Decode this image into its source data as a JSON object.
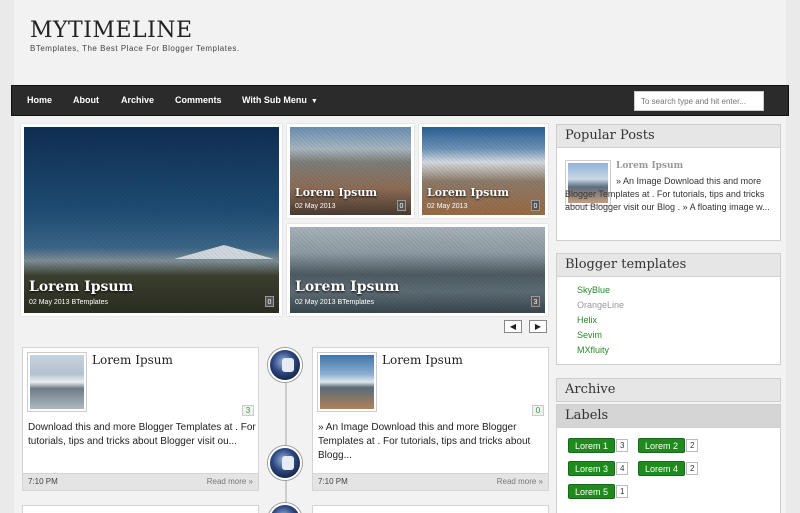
{
  "header": {
    "title": "MYTIMELINE",
    "description": "BTemplates, The Best Place For Blogger Templates."
  },
  "nav": {
    "items": [
      "Home",
      "About",
      "Archive",
      "Comments",
      "With Sub Menu"
    ],
    "submenu_icon": "caret-down-icon"
  },
  "search": {
    "placeholder": "To search type and hit enter..."
  },
  "slider": {
    "slides": [
      {
        "title": "Lorem Ipsum",
        "date": "02 May 2013",
        "author": "BTemplates",
        "comments": "0"
      },
      {
        "title": "Lorem Ipsum",
        "date": "02 May 2013",
        "comments": "0"
      },
      {
        "title": "Lorem Ipsum",
        "date": "02 May 2013",
        "comments": "0"
      },
      {
        "title": "Lorem Ipsum",
        "date": "02 May 2013",
        "author": "BTemplates",
        "comments": "3"
      }
    ],
    "prev_icon": "prev-arrow-icon",
    "next_icon": "next-arrow-icon"
  },
  "posts": [
    {
      "title": "Lorem Ipsum",
      "comments": "3",
      "excerpt": "Download this and more Blogger Templates at . For tutorials, tips and tricks about Blogger visit ou...",
      "time": "7:10 PM",
      "read_more": "Read more »"
    },
    {
      "title": "Lorem Ipsum",
      "comments": "0",
      "excerpt": "» An Image Download this and more Blogger Templates at . For tutorials, tips and tricks about Blogg...",
      "time": "7:10 PM",
      "read_more": "Read more »"
    }
  ],
  "sidebar": {
    "popular": {
      "title": "Popular Posts",
      "post_title": "Lorem Ipsum",
      "excerpt": "» An Image Download this and more Blogger Templates at . For tutorials, tips and tricks about Blogger visit our Blog . » A floating image w..."
    },
    "blogger_templates": {
      "title": "Blogger templates",
      "items": [
        {
          "name": "SkyBlue",
          "color": "#2a8a2a"
        },
        {
          "name": "OrangeLine",
          "color": "#999999"
        },
        {
          "name": "Helix",
          "color": "#2a8a2a"
        },
        {
          "name": "Sevim",
          "color": "#2a8a2a"
        },
        {
          "name": "MXfluity",
          "color": "#2a8a2a"
        }
      ]
    },
    "archive": {
      "title": "Archive"
    },
    "labels": {
      "title": "Labels",
      "items": [
        {
          "name": "Lorem 1",
          "count": "3"
        },
        {
          "name": "Lorem 2",
          "count": "2"
        },
        {
          "name": "Lorem 3",
          "count": "4"
        },
        {
          "name": "Lorem 4",
          "count": "2"
        },
        {
          "name": "Lorem 5",
          "count": "1"
        }
      ]
    }
  },
  "colors": {
    "navbar": "#2b2b2b",
    "accent_green": "#1f8b1f",
    "link_green": "#2a8a2a"
  }
}
